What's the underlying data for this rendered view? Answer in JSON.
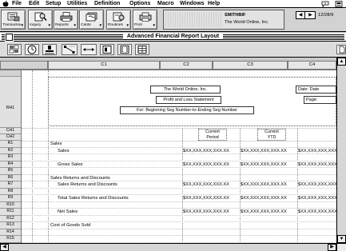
{
  "menu_bar": {
    "items": [
      "File",
      "Edit",
      "Setup",
      "Utilities",
      "Definition",
      "Options",
      "Macro",
      "Windows",
      "Help"
    ],
    "icons": [
      "apple-icon",
      "help-balloon-icon",
      "application-icon"
    ]
  },
  "toolbar": {
    "buttons": [
      {
        "label": "Transaction",
        "icon": "transaction-icon"
      },
      {
        "label": "Inquiry",
        "icon": "inquiry-icon"
      },
      {
        "label": "Reports",
        "icon": "reports-icon"
      },
      {
        "label": "Cards",
        "icon": "cards-icon"
      },
      {
        "label": "Routines",
        "icon": "routines-icon"
      },
      {
        "label": "Print",
        "icon": "print-icon"
      }
    ]
  },
  "session": {
    "user": "SMITHBIF",
    "company": "The World Online, Inc.",
    "date": "12/28/9"
  },
  "window": {
    "title": "Advanced Financial Report Layout"
  },
  "tools": [
    "format-tool-icon",
    "clock-icon",
    "stamp-icon",
    "line-tool-icon",
    "ruler-icon",
    "data-field-icon",
    "text-field-icon",
    "table-icon"
  ],
  "column_headers": [
    "C1",
    "C2",
    "C3",
    "C4"
  ],
  "row_headers": {
    "report_header": "RH1",
    "column_heads": [
      "CH1",
      "CH2"
    ]
  },
  "report_header": {
    "company": "The World Online, Inc.",
    "title": "Profit and Loss Statement",
    "range": "For: Beginning Seg Number-to-Ending Seg Number",
    "date": "Date: Date",
    "page": "Page:"
  },
  "column_titles": [
    {
      "line1": "Current",
      "line2": "Period"
    },
    {
      "line1": "Current",
      "line2": "YTD"
    }
  ],
  "rows": [
    {
      "id": "R1",
      "label": "Sales",
      "level": 0,
      "values": []
    },
    {
      "id": "R2",
      "label": "Sales",
      "level": 1,
      "values": [
        "$XX,XXX,XXX,XXX.XX",
        "$XX,XXX,XXX,XXX.XX",
        "$XX,XXX,XXX,XXX.XX"
      ]
    },
    {
      "id": "R3",
      "label": "",
      "level": 0,
      "values": []
    },
    {
      "id": "R4",
      "label": "Gross Sales",
      "level": 1,
      "values": [
        "$XX,XXX,XXX,XXX.XX",
        "$XX,XXX,XXX,XXX.XX",
        "$XX,XXX,XXX,XXX.XX"
      ]
    },
    {
      "id": "R5",
      "label": "",
      "level": 0,
      "values": []
    },
    {
      "id": "R6",
      "label": "Sales Returns and Discounts",
      "level": 0,
      "values": []
    },
    {
      "id": "R7",
      "label": "Sales Returns and Discounts",
      "level": 1,
      "values": [
        "$XX,XXX,XXX,XXX.XX",
        "$XX,XXX,XXX,XXX.XX",
        "$XX,XXX,XXX,XXX.XX"
      ]
    },
    {
      "id": "R8",
      "label": "",
      "level": 0,
      "values": []
    },
    {
      "id": "R9",
      "label": "Total Sales Returns and Discounts",
      "level": 1,
      "values": [
        "$XX,XXX,XXX,XXX.XX",
        "$XX,XXX,XXX,XXX.XX",
        "$XX,XXX,XXX,XXX.XX"
      ]
    },
    {
      "id": "R10",
      "label": "",
      "level": 0,
      "values": []
    },
    {
      "id": "R11",
      "label": "Net Sales",
      "level": 1,
      "values": [
        "$XX,XXX,XXX,XXX.XX",
        "$XX,XXX,XXX,XXX.XX",
        "$XX,XXX,XXX,XXX.XX"
      ]
    },
    {
      "id": "R12",
      "label": "",
      "level": 0,
      "values": []
    },
    {
      "id": "R13",
      "label": "Cost of Goods Sold",
      "level": 0,
      "values": []
    },
    {
      "id": "R14",
      "label": "",
      "level": 0,
      "values": []
    },
    {
      "id": "R15",
      "label": "",
      "level": 0,
      "values": []
    }
  ]
}
